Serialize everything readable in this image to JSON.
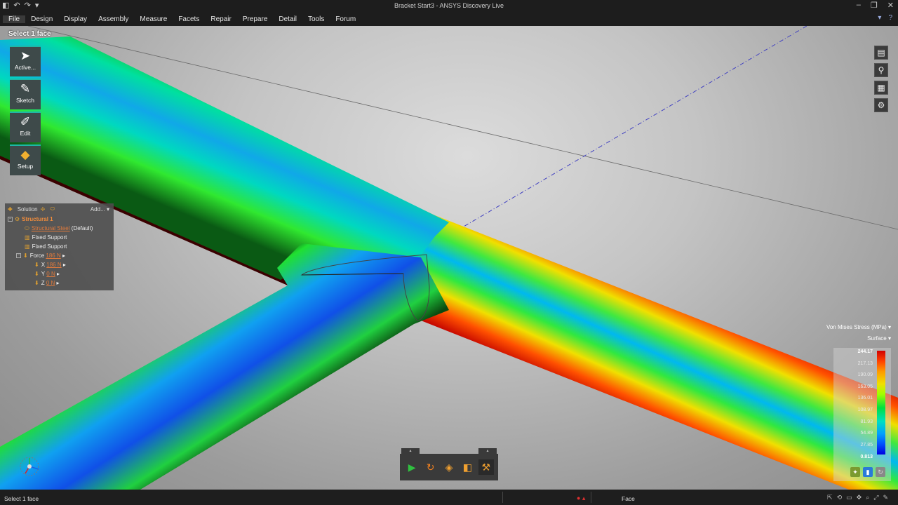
{
  "window": {
    "title": "Bracket Start3 - ANSYS Discovery Live"
  },
  "menu": {
    "items": [
      "File",
      "Design",
      "Display",
      "Assembly",
      "Measure",
      "Facets",
      "Repair",
      "Prepare",
      "Detail",
      "Tools",
      "Forum"
    ]
  },
  "prompt": "Select 1 face",
  "tools": [
    {
      "label": "Active...",
      "icon": "arrow-cursor-icon"
    },
    {
      "label": "Sketch",
      "icon": "pencil-icon"
    },
    {
      "label": "Edit",
      "icon": "edit-brush-icon"
    },
    {
      "label": "Setup",
      "icon": "setup-cube-icon"
    }
  ],
  "tree": {
    "header": {
      "label": "Solution",
      "add": "Add..."
    },
    "study": "Structural 1",
    "material": {
      "name": "Structural Steel",
      "suffix": "(Default)"
    },
    "supports": [
      "Fixed Support",
      "Fixed Support"
    ],
    "force": {
      "label": "Force",
      "value": "186 N",
      "components": [
        {
          "axis": "X",
          "value": "186 N"
        },
        {
          "axis": "Y",
          "value": "0 N"
        },
        {
          "axis": "Z",
          "value": "0 N"
        }
      ]
    }
  },
  "legend": {
    "quantity": "Von Mises Stress (MPa)",
    "mode": "Surface",
    "ticks": [
      "244.17",
      "217.13",
      "190.09",
      "163.05",
      "136.01",
      "108.97",
      "81.93",
      "54.89",
      "27.85",
      "0.813"
    ]
  },
  "status": {
    "left": "Select 1 face",
    "mode": "Face"
  },
  "colors": {
    "accent": "#1fb6a6",
    "max": "#d00000",
    "min": "#0000e0",
    "panel": "#3a3a3a"
  }
}
